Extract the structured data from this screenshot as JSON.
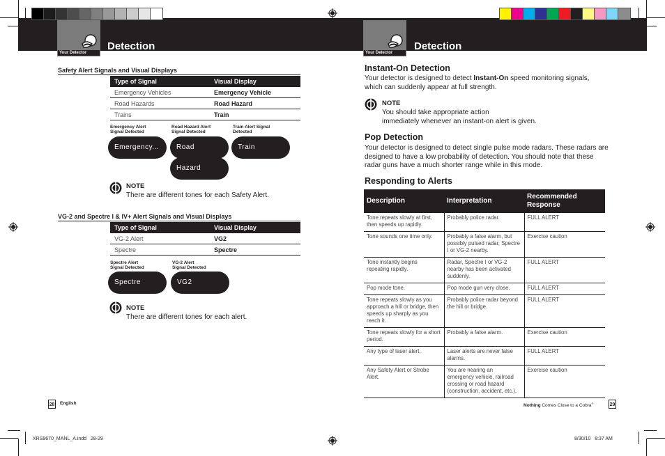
{
  "print_marks": {
    "gray_swatches": [
      "#000000",
      "#1c1c1c",
      "#333333",
      "#4d4d4d",
      "#666666",
      "#808080",
      "#999999",
      "#b3b3b3",
      "#cccccc",
      "#e6e6e6",
      "#ffffff"
    ],
    "color_swatches": [
      "#fff200",
      "#ec008c",
      "#00aeef",
      "#2e3192",
      "#00a651",
      "#ed1c24",
      "#231f20",
      "#fff685",
      "#f49ac2",
      "#7fd6f7",
      "#8c8c8c"
    ]
  },
  "left_page": {
    "tab_label": "Your Detector",
    "title": "Detection",
    "safety_section": {
      "title": "Safety Alert Signals and Visual Displays",
      "headers": [
        "Type of Signal",
        "Visual Display"
      ],
      "rows": [
        [
          "Emergency Vehicles",
          "Emergency Vehicle"
        ],
        [
          "Road Hazards",
          "Road Hazard"
        ],
        [
          "Trains",
          "Train"
        ]
      ],
      "displays": [
        {
          "caption_1": "Emergency Alert",
          "caption_2": "Signal Detected",
          "pill": "Emergency..."
        },
        {
          "caption_1": "Road Hazard Alert",
          "caption_2": "Signal Detected",
          "pill": "Road",
          "pill_2": "Hazard"
        },
        {
          "caption_1": "Train Alert Signal",
          "caption_2": "Detected",
          "pill": "Train"
        }
      ],
      "note_heading": "NOTE",
      "note_text": "There are different tones for each Safety Alert."
    },
    "vg2_section": {
      "title": "VG-2 and Spectre I & IV+ Alert Signals and Visual Displays",
      "headers": [
        "Type of Signal",
        "Visual Display"
      ],
      "rows": [
        [
          "VG-2 Alert",
          "VG2"
        ],
        [
          "Spectre",
          "Spectre"
        ]
      ],
      "displays": [
        {
          "caption_1": "Spectre Alert",
          "caption_2": "Signal Detected",
          "pill": "Spectre"
        },
        {
          "caption_1": "VG-2 Alert",
          "caption_2": "Signal Detected",
          "pill": "VG2"
        }
      ],
      "note_heading": "NOTE",
      "note_text": "There are different tones for each alert."
    },
    "page_number": "28",
    "footer_label": "English",
    "slug": "XRS9670_MANL_A.indd   28-29"
  },
  "right_page": {
    "tab_label": "Your Detector",
    "title": "Detection",
    "instant_on": {
      "heading": "Instant-On Detection",
      "text_before": "Your detector is designed to detect ",
      "text_bold": "Instant-On",
      "text_after": " speed monitoring signals, which can suddenly appear at full strength.",
      "note_heading": "NOTE",
      "note_line_1": "You should take appropriate action",
      "note_line_2": "immediately whenever an instant-on alert is given."
    },
    "pop": {
      "heading": "Pop Detection",
      "text": "Your detector is designed to detect single pulse mode radars. These radars are designed to have a low probability of detection. You should note that these radar guns have a much shorter range while in this mode."
    },
    "responding": {
      "heading": "Responding to Alerts",
      "headers": [
        "Description",
        "Interpretation",
        "Recommended Response"
      ],
      "rows": [
        [
          "Tone repeats slowly at first, then speeds up rapidly.",
          "Probably police radar.",
          "FULL ALERT"
        ],
        [
          "Tone sounds one time only.",
          "Probably a false alarm, but possibly pulsed radar, Spectre I or VG-2 nearby.",
          "Exercise caution"
        ],
        [
          "Tone instantly begins repeating rapidly.",
          "Radar, Spectre I or VG-2 nearby has been activated suddenly.",
          "FULL ALERT"
        ],
        [
          "Pop mode tone.",
          "Pop mode gun very close.",
          "FULL ALERT"
        ],
        [
          "Tone repeats slowly as you approach a hill or bridge, then speeds up sharply as you reach it.",
          "Probably police radar beyond the hill or bridge.",
          "FULL ALERT"
        ],
        [
          "Tone repeats slowly for a short period.",
          "Probably a false alarm.",
          "Exercise caution"
        ],
        [
          "Any type of laser alert.",
          "Laser alerts are never false alarms.",
          "FULL ALERT"
        ],
        [
          "Any Safety Alert or Strobe Alert.",
          "You are nearing an emergency vehicle, railroad crossing or road hazard (construction, accident, etc.).",
          "Exercise caution"
        ]
      ]
    },
    "footer_bold": "Nothing",
    "footer_text": " Comes Close to a Cobra",
    "footer_reg": "®",
    "page_number": "29",
    "slug_date": "8/30/10   8:37 AM"
  }
}
